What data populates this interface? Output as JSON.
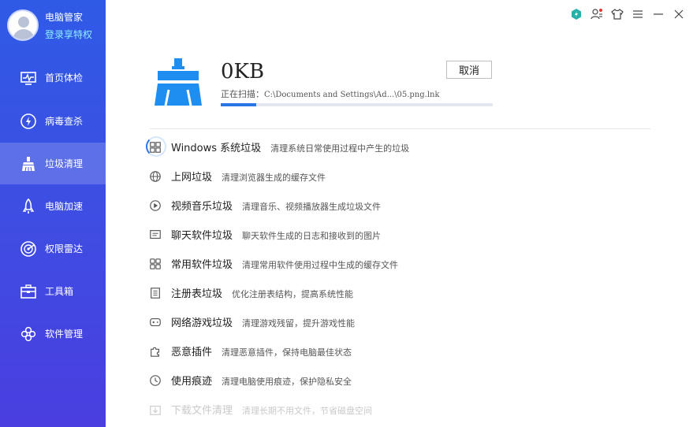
{
  "sidebar": {
    "user_name": "电脑管家",
    "login_link": "登录享特权",
    "items": [
      {
        "label": "首页体检",
        "icon": "monitor-pulse-icon"
      },
      {
        "label": "病毒查杀",
        "icon": "lightning-shield-icon"
      },
      {
        "label": "垃圾清理",
        "icon": "broom-icon",
        "active": true
      },
      {
        "label": "电脑加速",
        "icon": "rocket-icon"
      },
      {
        "label": "权限雷达",
        "icon": "radar-icon"
      },
      {
        "label": "工具箱",
        "icon": "toolbox-icon"
      },
      {
        "label": "软件管理",
        "icon": "apps-icon"
      }
    ]
  },
  "window": {
    "controls": [
      "app-badge-icon",
      "user-notify-icon",
      "skin-shirt-icon",
      "menu-icon",
      "minimize-icon",
      "close-icon"
    ]
  },
  "scan": {
    "size": "0KB",
    "cancel_label": "取消",
    "status_prefix": "正在扫描：",
    "status_path": "C:\\Documents and Settings\\Ad...\\05.png.lnk",
    "progress": 0.13
  },
  "items": [
    {
      "name": "Windows 系统垃圾",
      "desc": "清理系统日常使用过程中产生的垃圾",
      "icon": "windows-grid-icon"
    },
    {
      "name": "上网垃圾",
      "desc": "清理浏览器生成的缓存文件",
      "icon": "globe-icon"
    },
    {
      "name": "视频音乐垃圾",
      "desc": "清理音乐、视频播放器生成垃圾文件",
      "icon": "play-circle-icon"
    },
    {
      "name": "聊天软件垃圾",
      "desc": "聊天软件生成的日志和接收到的图片",
      "icon": "chat-icon"
    },
    {
      "name": "常用软件垃圾",
      "desc": "清理常用软件使用过程中生成的缓存文件",
      "icon": "app-grid-icon"
    },
    {
      "name": "注册表垃圾",
      "desc": "优化注册表结构，提高系统性能",
      "icon": "registry-icon"
    },
    {
      "name": "网络游戏垃圾",
      "desc": "清理游戏残留，提升游戏性能",
      "icon": "gamepad-icon"
    },
    {
      "name": "恶意插件",
      "desc": "清理恶意插件，保持电脑最佳状态",
      "icon": "puzzle-icon"
    },
    {
      "name": "使用痕迹",
      "desc": "清理电脑使用痕迹，保护隐私安全",
      "icon": "clock-icon"
    },
    {
      "name": "下载文件清理",
      "desc": "清理长期不用文件，节省磁盘空间",
      "icon": "download-box-icon",
      "faded": true
    }
  ]
}
